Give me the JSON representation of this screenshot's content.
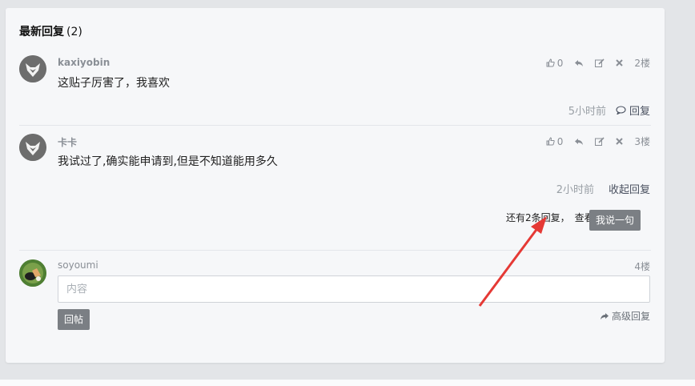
{
  "header": {
    "title": "最新回复",
    "count": "(2)"
  },
  "replies": [
    {
      "author": "kaxiyobin",
      "content": "这贴子厉害了，我喜欢",
      "likes": "0",
      "floor": "2楼",
      "time": "5小时前",
      "action_label": "回复"
    },
    {
      "author": "卡卡",
      "content": "我试过了,确实能申请到,但是不知道能用多久",
      "likes": "0",
      "floor": "3楼",
      "time": "2小时前",
      "action_label": "收起回复",
      "more_text": "还有2条回复，",
      "view_text": "查看",
      "say_button": "我说一句"
    }
  ],
  "compose": {
    "username": "soyoumi",
    "floor": "4楼",
    "placeholder": "内容",
    "post_button": "回帖",
    "advanced_label": "高级回复"
  },
  "colors": {
    "annotation_arrow": "#e53935",
    "button_gray": "#7b7f84"
  },
  "icons": [
    "thumbs-up-icon",
    "reply-arrow-icon",
    "edit-icon",
    "delete-icon",
    "comment-icon",
    "share-icon"
  ]
}
